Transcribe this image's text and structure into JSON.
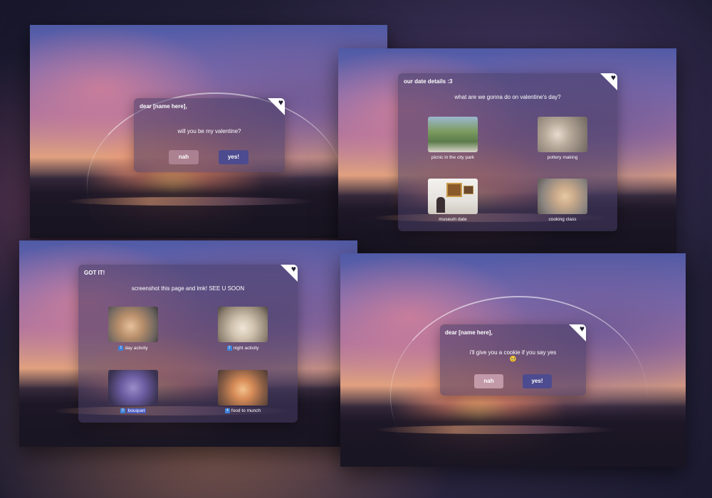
{
  "icons": {
    "heart": "heart-icon",
    "heart_glyph": "♥"
  },
  "colors": {
    "card": "#463c64",
    "yes_button": "#4d4b8f",
    "nah_button": "#d2aabe",
    "step_badge": "#3f82d9"
  },
  "screen1": {
    "heading": "dear [name here],",
    "question": "will you be my valentine?",
    "nah_label": "nah",
    "yes_label": "yes!"
  },
  "screen2": {
    "heading": "our date details :3",
    "question": "what are we gonna do on valentine's day?",
    "options": [
      {
        "label": "picnic in the city park"
      },
      {
        "label": "pottery making"
      },
      {
        "label": "museum date"
      },
      {
        "label": "cooking class"
      }
    ]
  },
  "screen3": {
    "heading": "GOT IT!",
    "instruction": "screenshot this page and lmk! SEE U SOON",
    "picks": [
      {
        "num": "1",
        "label": "day activity"
      },
      {
        "num": "2",
        "label": "night activity"
      },
      {
        "num": "3",
        "label": "bouquet"
      },
      {
        "num": "4",
        "label": "food to munch"
      }
    ]
  },
  "screen4": {
    "heading": "dear [name here],",
    "question": "i'll give you a cookie if you say yes",
    "emoji": "🥺",
    "nah_label": "nah",
    "yes_label": "yes!"
  }
}
